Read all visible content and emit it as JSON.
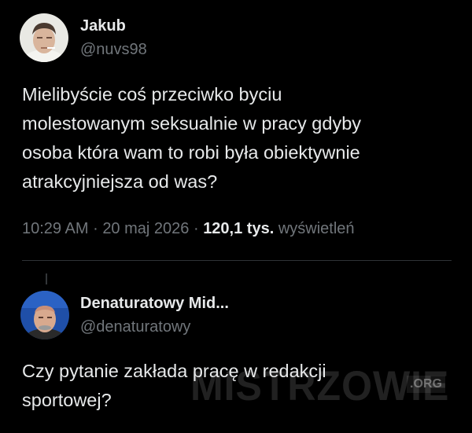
{
  "tweet": {
    "author_name": "Jakub",
    "author_handle": "@nuvs98",
    "text_lines": [
      "Mielibyście coś przeciwko byciu",
      "molestowanym seksualnie w pracy gdyby",
      "osoba która wam to robi była obiektywnie",
      "atrakcyjniejsza od was?"
    ],
    "time": "10:29 AM",
    "separator": "·",
    "date": "20 maj 2026",
    "views_count": "120,1 tys.",
    "views_label": "wyświetleń"
  },
  "reply": {
    "author_name": "Denaturatowy Mid...",
    "author_handle": "@denaturatowy",
    "text_lines": [
      "Czy pytanie zakłada pracę w redakcji",
      "sportowej?"
    ]
  },
  "watermark": {
    "main": "MISTRZOWIE",
    "suffix": ".ORG"
  },
  "icons": {
    "avatar_1": "user-avatar-photo",
    "avatar_2": "user-avatar-photo"
  },
  "colors": {
    "background": "#000000",
    "text_primary": "#e7e9ea",
    "text_secondary": "#71767b",
    "divider": "#2f3336"
  }
}
